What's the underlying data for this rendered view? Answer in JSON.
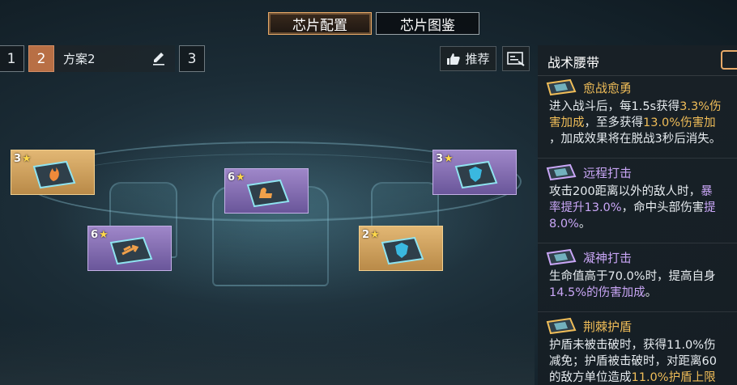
{
  "tabs": [
    {
      "label": "芯片配置",
      "active": true
    },
    {
      "label": "芯片图鉴",
      "active": false
    }
  ],
  "plans": {
    "buttons": [
      "1",
      "2",
      "3"
    ],
    "active": "2",
    "name": "方案2"
  },
  "toolbar": {
    "recommend_label": "推荐"
  },
  "slots": [
    {
      "level": "3",
      "rarity": "gold",
      "icon": "flame-chip-icon"
    },
    {
      "level": "6",
      "rarity": "purple",
      "icon": "arrow-chip-icon"
    },
    {
      "level": "6",
      "rarity": "purple",
      "icon": "arm-chip-icon"
    },
    {
      "level": "2",
      "rarity": "gold",
      "icon": "shield-chip-icon"
    },
    {
      "level": "3",
      "rarity": "purple",
      "icon": "shield-chip-icon"
    }
  ],
  "panel": {
    "title": "战术腰带",
    "effects": [
      {
        "name": "愈战愈勇",
        "name_color": "#f0bd58",
        "lines": [
          [
            {
              "t": "进入战斗后，每1.5s获得"
            },
            {
              "t": "3.3%伤",
              "c": "hl-gold"
            }
          ],
          [
            {
              "t": "害加成",
              "c": "hl-gold"
            },
            {
              "t": "，至多获得"
            },
            {
              "t": "13.0%伤害加",
              "c": "hl-gold"
            }
          ],
          [
            {
              "t": "，加成效果将在脱战3秒后消失。"
            }
          ]
        ]
      },
      {
        "name": "远程打击",
        "name_color": "#c9a6f6",
        "lines": [
          [
            {
              "t": "攻击200距离以外的敌人时，"
            },
            {
              "t": "暴",
              "c": "hl-purple"
            }
          ],
          [
            {
              "t": "率提升13.0%",
              "c": "hl-purple"
            },
            {
              "t": "，命中头部伤害"
            },
            {
              "t": "提",
              "c": "hl-purple"
            }
          ],
          [
            {
              "t": "8.0%",
              "c": "hl-purple"
            },
            {
              "t": "。"
            }
          ]
        ]
      },
      {
        "name": "凝神打击",
        "name_color": "#c9a6f6",
        "lines": [
          [
            {
              "t": "生命值高于70.0%时，提高自身"
            }
          ],
          [
            {
              "t": "14.5%的伤害加成",
              "c": "hl-purple"
            },
            {
              "t": "。"
            }
          ]
        ]
      },
      {
        "name": "荆棘护盾",
        "name_color": "#f0bd58",
        "lines": [
          [
            {
              "t": "护盾未被击破时，获得11.0%伤"
            }
          ],
          [
            {
              "t": "减免；护盾被击破时，对距离60"
            }
          ],
          [
            {
              "t": "的敌方单位造成"
            },
            {
              "t": "11.0%护盾上限",
              "c": "hl-gold"
            }
          ]
        ]
      }
    ]
  }
}
